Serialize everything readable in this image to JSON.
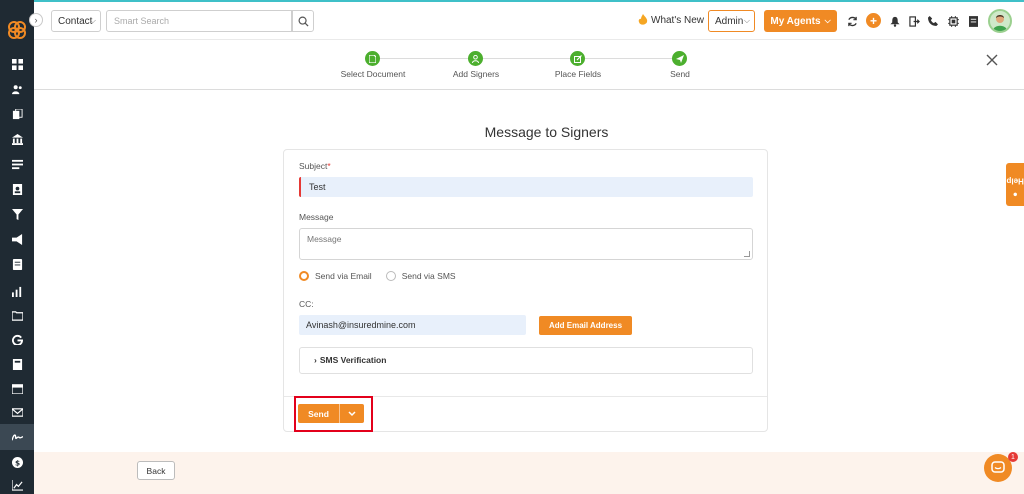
{
  "header": {
    "contact_select": "Contact",
    "search_placeholder": "Smart Search",
    "whats_new": "What's New",
    "admin_select": "Admin",
    "agents_button": "My Agents",
    "plus_label": "+"
  },
  "stepper": {
    "steps": [
      {
        "label": "Select Document"
      },
      {
        "label": "Add Signers"
      },
      {
        "label": "Place Fields"
      },
      {
        "label": "Send"
      }
    ]
  },
  "main": {
    "title": "Message to Signers",
    "subject_label": "Subject",
    "subject_required": "*",
    "subject_value": "Test",
    "message_label": "Message",
    "message_placeholder": "Message",
    "radio_email": "Send via Email",
    "radio_sms": "Send via SMS",
    "selected_delivery": "Send via Email",
    "cc_label": "CC:",
    "cc_value": "Avinash@insuredmine.com",
    "add_email_button": "Add Email Address",
    "sms_verification": "SMS Verification",
    "send_button": "Send"
  },
  "footer": {
    "back_button": "Back"
  },
  "help_tab": "Help",
  "chat_badge": "1",
  "colors": {
    "accent": "#f08a24",
    "sidebar": "#1f2a33",
    "step_done": "#4caf2e",
    "highlight": "#e3001b"
  }
}
